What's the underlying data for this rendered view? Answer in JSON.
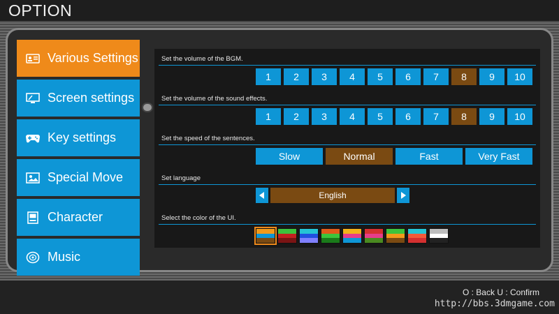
{
  "header": {
    "title": "OPTION"
  },
  "menu": {
    "items": [
      {
        "label": "Various Settings",
        "icon": "id-card-icon",
        "active": true
      },
      {
        "label": "Screen settings",
        "icon": "monitor-icon",
        "active": false
      },
      {
        "label": "Key settings",
        "icon": "gamepad-icon",
        "active": false
      },
      {
        "label": "Special Move",
        "icon": "picture-icon",
        "active": false
      },
      {
        "label": "Character",
        "icon": "arcade-icon",
        "active": false
      },
      {
        "label": "Music",
        "icon": "disc-icon",
        "active": false
      }
    ]
  },
  "settings": {
    "bgm": {
      "label": "Set the volume of the BGM.",
      "levels": [
        "1",
        "2",
        "3",
        "4",
        "5",
        "6",
        "7",
        "8",
        "9",
        "10"
      ],
      "selected": "8"
    },
    "sfx": {
      "label": "Set the volume of the sound effects.",
      "levels": [
        "1",
        "2",
        "3",
        "4",
        "5",
        "6",
        "7",
        "8",
        "9",
        "10"
      ],
      "selected": "8"
    },
    "speed": {
      "label": "Set the speed of the sentences.",
      "options": [
        "Slow",
        "Normal",
        "Fast",
        "Very Fast"
      ],
      "selected": "Normal"
    },
    "language": {
      "label": "Set language",
      "value": "English"
    },
    "ui_color": {
      "label": "Select the color of the UI.",
      "swatches": [
        [
          "#f29a1a",
          "#0e96d6",
          "#7a4a12"
        ],
        [
          "#3cc43c",
          "#c42020",
          "#7a1414"
        ],
        [
          "#25c4d4",
          "#2050e0",
          "#8080ff"
        ],
        [
          "#e05a1a",
          "#3cc43c",
          "#1a7a1a"
        ],
        [
          "#f2b21a",
          "#e63d8a",
          "#0e96d6"
        ],
        [
          "#d43030",
          "#e63d8a",
          "#4a8a20"
        ],
        [
          "#3cc43c",
          "#f29a1a",
          "#7a4a12"
        ],
        [
          "#25c4d4",
          "#f25a3a",
          "#d43030"
        ],
        [
          "#bdbdbd",
          "#ffffff",
          "#222222"
        ]
      ],
      "selected_index": 0
    }
  },
  "footer": {
    "hint": "O : Back  U : Confirm",
    "watermark": "http://bbs.3dmgame.com"
  },
  "colors": {
    "accent": "#0e96d6",
    "active": "#ef8a1a",
    "selected": "#7a4a12"
  }
}
